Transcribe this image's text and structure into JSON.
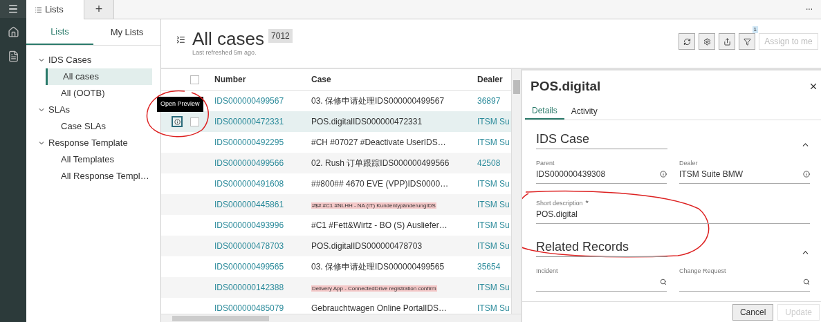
{
  "top_tabs": [
    {
      "label": "Lists",
      "selected": true
    },
    {
      "label": "+",
      "selected": false
    }
  ],
  "more_menu": "...",
  "sidebar": {
    "tabs": [
      {
        "label": "Lists",
        "selected": true
      },
      {
        "label": "My Lists",
        "selected": false
      }
    ],
    "tree": [
      {
        "label": "IDS Cases",
        "expanded": true,
        "children": [
          {
            "label": "All cases",
            "selected": true
          },
          {
            "label": "All (OOTB)",
            "selected": false
          }
        ]
      },
      {
        "label": "SLAs",
        "expanded": true,
        "children": [
          {
            "label": "Case SLAs",
            "selected": false
          }
        ]
      },
      {
        "label": "Response Template",
        "expanded": true,
        "children": [
          {
            "label": "All Templates",
            "selected": false
          },
          {
            "label": "All Response Templ…",
            "selected": false
          }
        ]
      }
    ]
  },
  "list": {
    "title": "All cases",
    "count": "7012",
    "subtitle": "Last refreshed 5m ago.",
    "filter_badge": "1",
    "assign_button": {
      "label": "Assign to me",
      "disabled": true
    },
    "tooltip": "Open Preview",
    "header_checked": false,
    "columns": [
      "Number",
      "Case",
      "Dealer"
    ],
    "rows": [
      {
        "number": "IDS000000499567",
        "case": "03. 保修申请处理IDS000000499567",
        "kind": "text",
        "dealer": "36897",
        "selected": false
      },
      {
        "number": "IDS000000472331",
        "case": "POS.digitalIDS000000472331",
        "kind": "text",
        "dealer": "ITSM Su",
        "selected": true
      },
      {
        "number": "IDS000000492295",
        "case": "#CH #07027 #Deactivate UserIDS…",
        "kind": "text",
        "dealer": "ITSM Su",
        "selected": false
      },
      {
        "number": "IDS000000499566",
        "case": "02. Rush 订单跟踪IDS000000499566",
        "kind": "text",
        "dealer": "42508",
        "selected": false
      },
      {
        "number": "IDS000000491608",
        "case": "##800## 4670 EVE (VPP)IDS0000…",
        "kind": "text",
        "dealer": "ITSM Su",
        "selected": false
      },
      {
        "number": "IDS000000445861",
        "case": "#$# #C1 #NLHH - NA (IT) KundentypänderungIDS",
        "kind": "highlight",
        "dealer": "ITSM Su",
        "selected": false
      },
      {
        "number": "IDS000000493996",
        "case": "#C1 #Fett&Wirtz - BO (S) Ausliefer…",
        "kind": "text",
        "dealer": "ITSM Su",
        "selected": false
      },
      {
        "number": "IDS000000478703",
        "case": "POS.digitalIDS000000478703",
        "kind": "text",
        "dealer": "ITSM Su",
        "selected": false
      },
      {
        "number": "IDS000000499565",
        "case": "03. 保修申请处理IDS000000499565",
        "kind": "text",
        "dealer": "35654",
        "selected": false
      },
      {
        "number": "IDS000000142388",
        "case": "Delivery App - ConnectedDrive registration confirm",
        "kind": "highlight",
        "dealer": "ITSM Su",
        "selected": false
      },
      {
        "number": "IDS000000485079",
        "case": "Gebrauchtwagen Online PortalIDS…",
        "kind": "text",
        "dealer": "ITSM Su",
        "selected": false
      }
    ]
  },
  "preview": {
    "title": "POS.digital",
    "tabs": [
      {
        "label": "Details",
        "selected": true
      },
      {
        "label": "Activity",
        "selected": false
      }
    ],
    "sections": [
      {
        "title": "IDS Case",
        "fields": [
          {
            "label": "Parent",
            "value": "IDS000000439308",
            "kind": "info"
          },
          {
            "label": "Dealer",
            "value": "ITSM Suite BMW",
            "kind": "info"
          },
          {
            "label": "Short description",
            "value": "POS.digital",
            "kind": "wide",
            "required_mark": "*"
          }
        ]
      },
      {
        "title": "Related Records",
        "fields": [
          {
            "label": "Incident",
            "kind": "search"
          },
          {
            "label": "Change Request",
            "kind": "search"
          }
        ]
      }
    ],
    "buttons": [
      {
        "label": "Cancel",
        "disabled": false
      },
      {
        "label": "Update",
        "disabled": true
      }
    ]
  }
}
